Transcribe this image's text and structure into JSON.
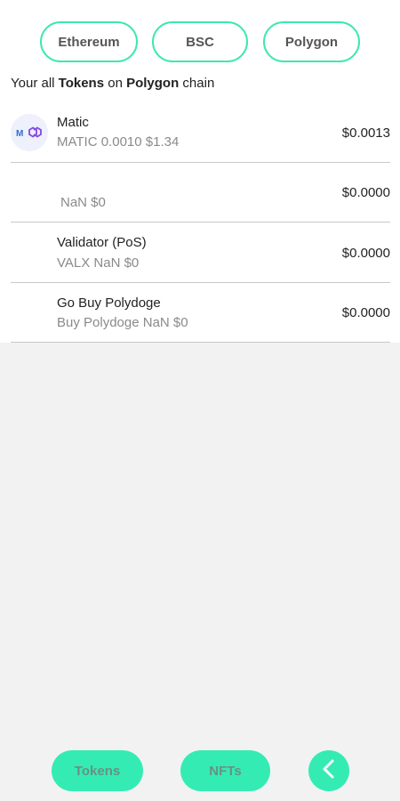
{
  "chains": {
    "ethereum": "Ethereum",
    "bsc": "BSC",
    "polygon": "Polygon"
  },
  "heading": {
    "prefix": "Your all ",
    "tokens": "Tokens",
    "middle": " on ",
    "chain": "Polygon",
    "suffix": " chain"
  },
  "tokens": [
    {
      "name": "Matic",
      "sub": "MATIC 0.0010 $1.34",
      "usd": "$0.0013",
      "icon": "polygon-matic-icon"
    },
    {
      "name": "",
      "sub": "NaN $0",
      "usd": "$0.0000"
    },
    {
      "name": "Validator (PoS)",
      "sub": "VALX NaN $0",
      "usd": "$0.0000"
    },
    {
      "name": "Go Buy Polydoge",
      "sub": "Buy Polydoge NaN $0",
      "usd": "$0.0000"
    }
  ],
  "bottom": {
    "tokens_label": "Tokens",
    "nfts_label": "NFTs",
    "back_icon": "chevron-left-icon"
  },
  "colors": {
    "accent": "#34ecb3",
    "accent_border": "#3de8b0",
    "matic_purple": "#8247e5"
  }
}
